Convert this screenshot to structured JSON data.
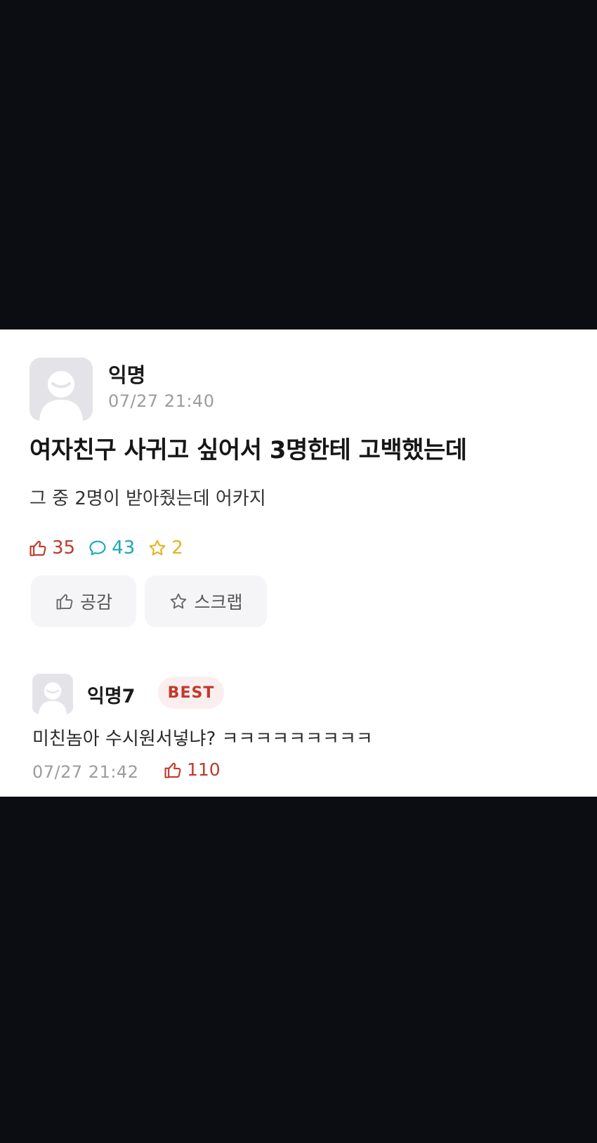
{
  "post": {
    "author": "익명",
    "time": "07/27 21:40",
    "title": "여자친구 사귀고 싶어서 3명한테 고백했는데",
    "body": "그 중 2명이 받아줬는데 어카지",
    "stats": {
      "likes": "35",
      "comments": "43",
      "scraps": "2"
    },
    "actions": {
      "like_label": "공감",
      "scrap_label": "스크랩"
    }
  },
  "comment": {
    "author": "익명7",
    "badge": "BEST",
    "text": "미친놈아 수시원서넣냐? ㅋㅋㅋㅋㅋㅋㅋㅋㅋ",
    "time": "07/27 21:42",
    "likes": "110"
  },
  "icons": {
    "like": "thumbs-up-icon",
    "comment": "speech-bubble-icon",
    "scrap": "star-icon",
    "avatar": "default-avatar-icon"
  },
  "colors": {
    "like": "#c0392b",
    "comment": "#1aa8bd",
    "scrap": "#e3b31d",
    "background": "#0b0d13"
  }
}
